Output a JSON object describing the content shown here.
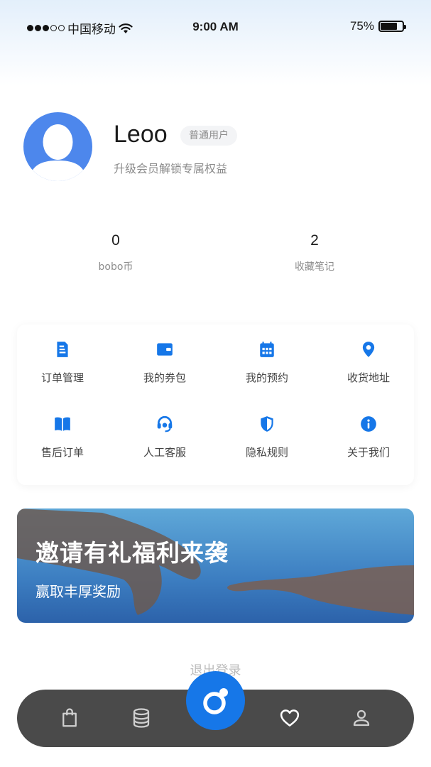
{
  "status_bar": {
    "carrier": "中国移动",
    "time": "9:00 AM",
    "battery": "75%",
    "battery_level": 0.75
  },
  "profile": {
    "name": "Leoo",
    "badge": "普通用户",
    "subtitle": "升级会员解锁专属权益"
  },
  "stats": [
    {
      "value": "0",
      "label": "bobo币"
    },
    {
      "value": "2",
      "label": "收藏笔记"
    }
  ],
  "menu": [
    {
      "label": "订单管理",
      "icon": "order-document-icon"
    },
    {
      "label": "我的券包",
      "icon": "wallet-icon"
    },
    {
      "label": "我的预约",
      "icon": "calendar-icon"
    },
    {
      "label": "收货地址",
      "icon": "location-pin-icon"
    },
    {
      "label": "售后订单",
      "icon": "book-icon"
    },
    {
      "label": "人工客服",
      "icon": "headset-icon"
    },
    {
      "label": "隐私规则",
      "icon": "shield-icon"
    },
    {
      "label": "关于我们",
      "icon": "info-icon"
    }
  ],
  "banner": {
    "title": "邀请有礼福利来袭",
    "subtitle": "赢取丰厚奖励"
  },
  "logout": "退出登录",
  "tabbar": {
    "icons": [
      "shopping-bag-icon",
      "coins-stack-icon",
      "home-center-icon",
      "heart-icon",
      "profile-icon"
    ]
  },
  "colors": {
    "accent": "#1677e8",
    "avatar": "#4d87ec",
    "tabbar": "#4a4a4a"
  }
}
